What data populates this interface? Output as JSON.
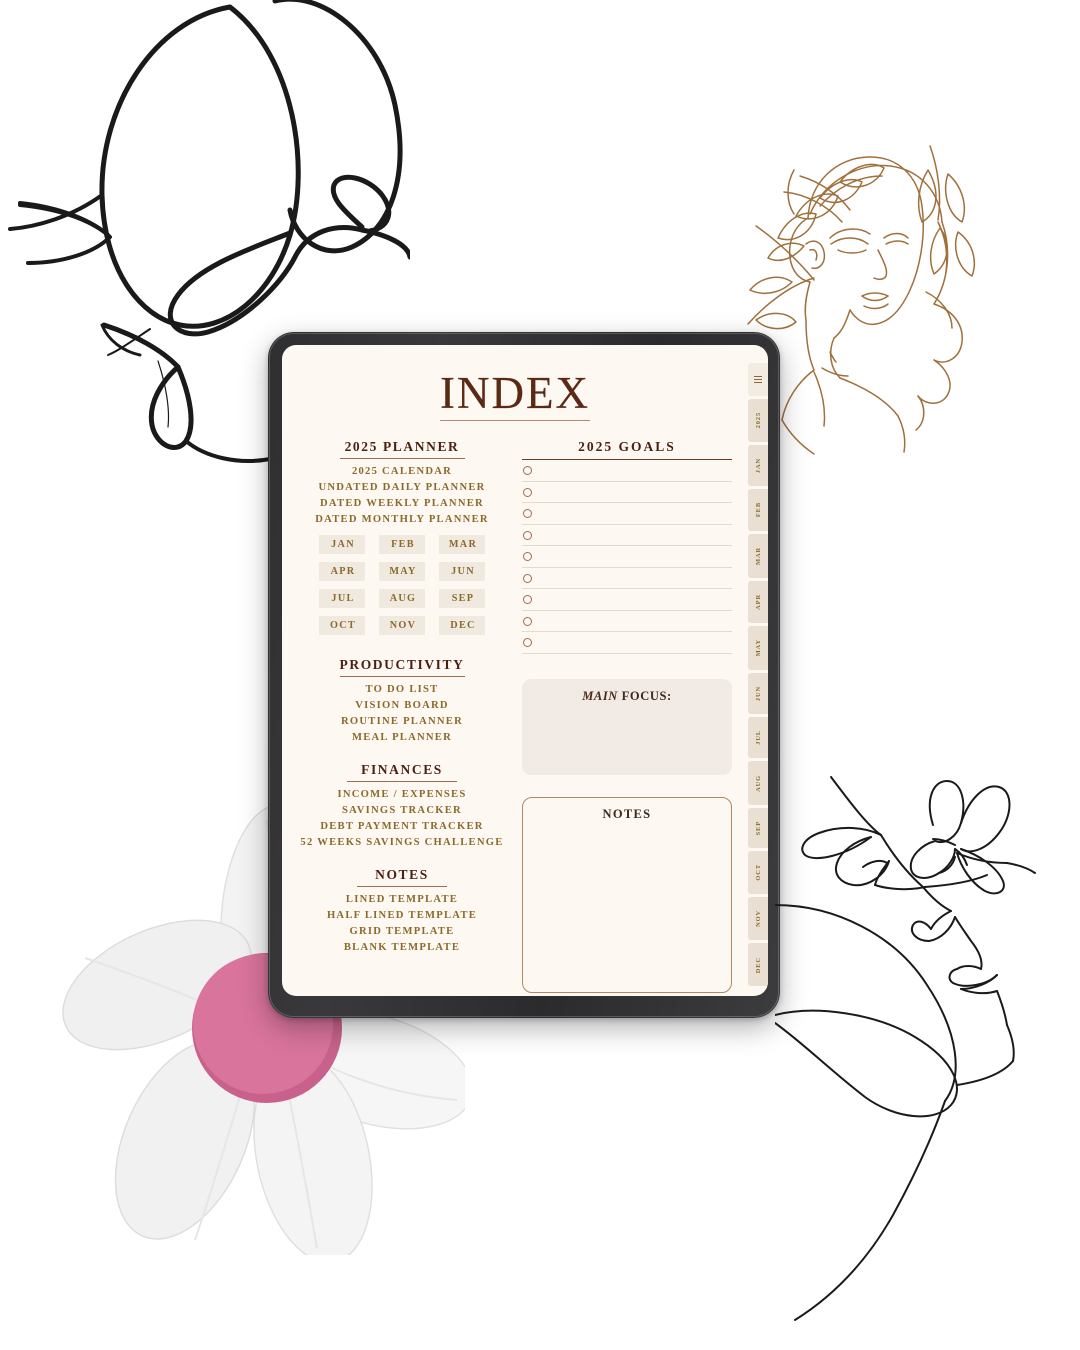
{
  "page": {
    "title": "INDEX"
  },
  "left_column": {
    "planner": {
      "header": "2025 PLANNER",
      "items": [
        "2025 CALENDAR",
        "UNDATED DAILY PLANNER",
        "DATED WEEKLY PLANNER",
        "DATED MONTHLY PLANNER"
      ],
      "months": [
        "JAN",
        "FEB",
        "MAR",
        "APR",
        "MAY",
        "JUN",
        "JUL",
        "AUG",
        "SEP",
        "OCT",
        "NOV",
        "DEC"
      ]
    },
    "productivity": {
      "header": "PRODUCTIVITY",
      "items": [
        "TO DO LIST",
        "VISION BOARD",
        "ROUTINE PLANNER",
        "MEAL PLANNER"
      ]
    },
    "finances": {
      "header": "FINANCES",
      "items": [
        "INCOME / EXPENSES",
        "SAVINGS TRACKER",
        "DEBT PAYMENT TRACKER",
        "52 WEEKS SAVINGS CHALLENGE"
      ]
    },
    "notes": {
      "header": "NOTES",
      "items": [
        "LINED TEMPLATE",
        "HALF LINED TEMPLATE",
        "GRID TEMPLATE",
        "BLANK TEMPLATE"
      ]
    }
  },
  "right_column": {
    "goals": {
      "header": "2025 GOALS",
      "rows": [
        "",
        "",
        "",
        "",
        "",
        "",
        "",
        "",
        ""
      ]
    },
    "main_focus": {
      "title_emphasis": "MAIN",
      "title_rest": " FOCUS:",
      "value": ""
    },
    "notes_box": {
      "title": "NOTES",
      "value": ""
    }
  },
  "tab_rail": {
    "menu_icon": "hamburger-menu-icon",
    "tabs": [
      "2025",
      "JAN",
      "FEB",
      "MAR",
      "APR",
      "MAY",
      "JUN",
      "JUL",
      "AUG",
      "SEP",
      "OCT",
      "NOV",
      "DEC"
    ]
  },
  "decorations": {
    "butterfly": "butterfly-line-art",
    "goddess": "goddess-laurel-line-art",
    "face": "face-profile-butterfly-line-art",
    "flower": "white-flower-pink-center"
  },
  "colors": {
    "screen_bg": "#fdf8f2",
    "heading": "#4a1f12",
    "link": "#8b6a2b",
    "rule": "#9c6f52",
    "chip_bg": "#efe9df",
    "focus_bg": "#f2ebe5",
    "notes_border": "#b08a62",
    "bezel": "#2f2f31",
    "line_art_brown": "#a0703c",
    "line_art_black": "#1a1a1a",
    "flower_center": "#d9749d"
  }
}
